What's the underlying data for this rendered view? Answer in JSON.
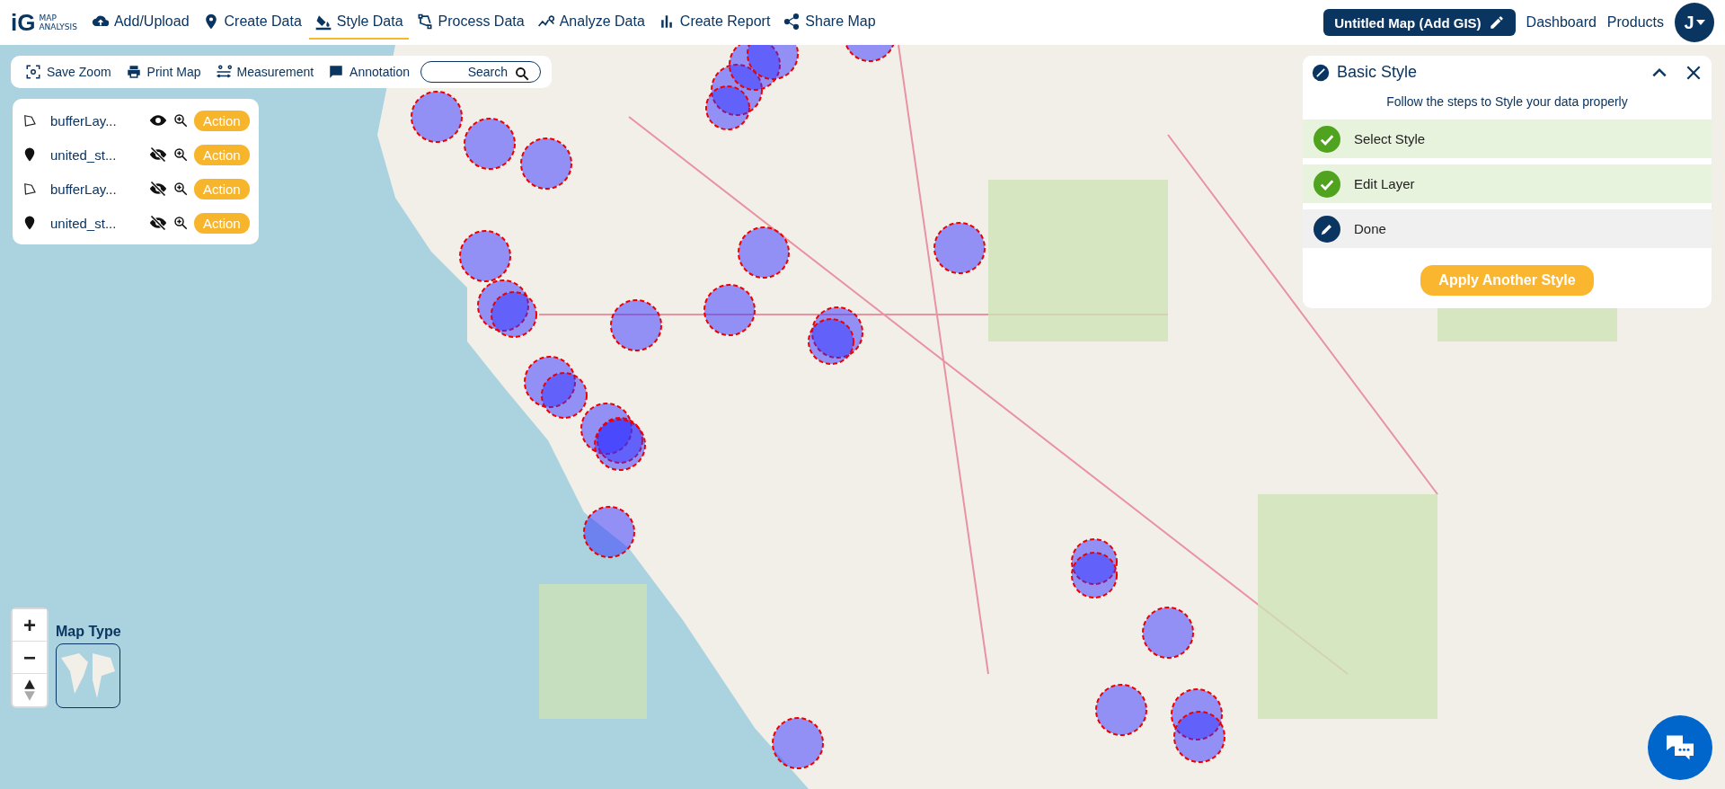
{
  "logo": {
    "mark": "iG",
    "text_1": "MAP",
    "text_2": "ANALYSIS"
  },
  "nav": [
    {
      "label": "Add/Upload",
      "selected": false
    },
    {
      "label": "Create Data",
      "selected": false
    },
    {
      "label": "Style Data",
      "selected": true
    },
    {
      "label": "Process Data",
      "selected": false
    },
    {
      "label": "Analyze Data",
      "selected": false
    },
    {
      "label": "Create Report",
      "selected": false
    },
    {
      "label": "Share Map",
      "selected": false
    }
  ],
  "map_title": "Untitled Map (Add GIS)",
  "header_links": [
    "Dashboard",
    "Products"
  ],
  "avatar": "J",
  "toolbar": [
    {
      "label": "Save Zoom"
    },
    {
      "label": "Print Map"
    },
    {
      "label": "Measurement"
    },
    {
      "label": "Annotation"
    }
  ],
  "search": {
    "placeholder": "Search"
  },
  "layers": [
    {
      "kind": "polygon",
      "name": "bufferLay...",
      "visible": true,
      "action": "Action"
    },
    {
      "kind": "point",
      "name": "united_st...",
      "visible": false,
      "action": "Action"
    },
    {
      "kind": "polygon",
      "name": "bufferLay...",
      "visible": false,
      "action": "Action"
    },
    {
      "kind": "point",
      "name": "united_st...",
      "visible": false,
      "action": "Action"
    }
  ],
  "style_panel": {
    "title": "Basic Style",
    "subtitle": "Follow the steps to Style your data properly",
    "steps": [
      {
        "label": "Select Style",
        "done": true
      },
      {
        "label": "Edit Layer",
        "done": true
      },
      {
        "label": "Done",
        "done": false
      }
    ],
    "button": "Apply Another Style"
  },
  "zoom_controls": {
    "zoom_in": "+",
    "zoom_out": "−"
  },
  "map_type": {
    "label": "Map Type"
  }
}
